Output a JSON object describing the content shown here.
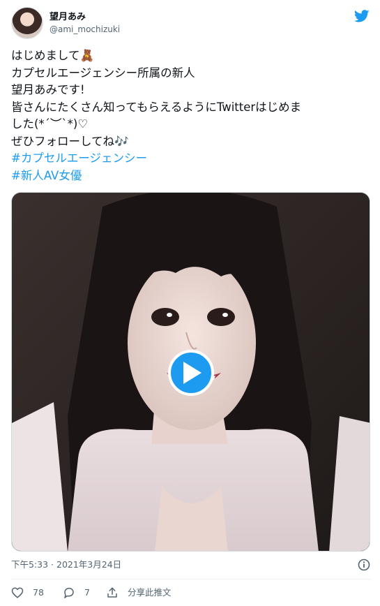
{
  "user": {
    "display_name": "望月あみ",
    "handle": "@ami_mochizuki"
  },
  "tweet": {
    "lines": [
      "はじめまして🧸",
      "カプセルエージェンシー所属の新人",
      "望月あみです!",
      "皆さんにたくさん知ってもらえるようにTwitterはじめま",
      "した(*´︶`*)♡",
      "ぜひフォローしてね🎶"
    ],
    "hashtags": [
      "#カプセルエージェンシー",
      "#新人AV女優"
    ]
  },
  "media": {
    "type": "video"
  },
  "meta": {
    "timestamp": "下午5:33 · 2021年3月24日"
  },
  "actions": {
    "likes": "78",
    "replies": "7",
    "share_label": "分享此推文"
  },
  "colors": {
    "accent": "#1d9bf0",
    "text": "#0f1419",
    "secondary": "#536471"
  },
  "icons": [
    "twitter-logo-icon",
    "play-icon",
    "info-icon",
    "heart-icon",
    "reply-icon",
    "share-icon"
  ]
}
